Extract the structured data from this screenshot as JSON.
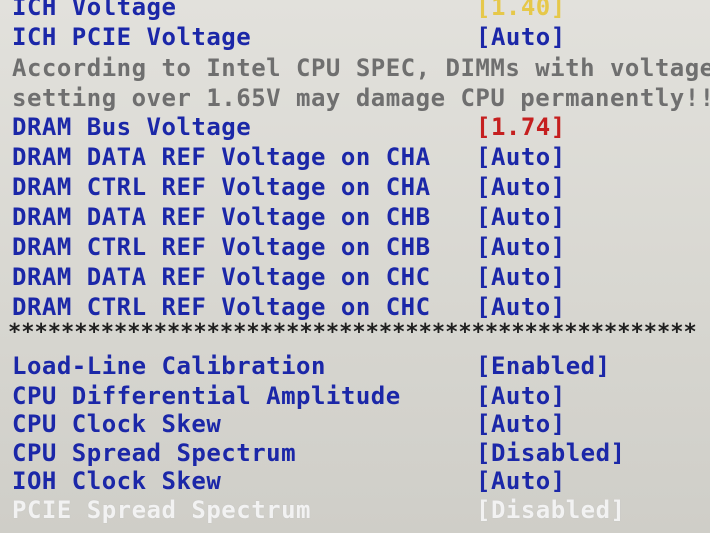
{
  "rows": [
    {
      "label": "ICH Voltage",
      "value": "[1.40]"
    },
    {
      "label": "ICH PCIE Voltage",
      "value": "[Auto]"
    },
    {
      "label": "DRAM Bus Voltage",
      "value": "[1.74]"
    },
    {
      "label": "DRAM DATA REF Voltage on CHA",
      "value": "[Auto]"
    },
    {
      "label": "DRAM CTRL REF Voltage on CHA",
      "value": "[Auto]"
    },
    {
      "label": "DRAM DATA REF Voltage on CHB",
      "value": "[Auto]"
    },
    {
      "label": "DRAM CTRL REF Voltage on CHB",
      "value": "[Auto]"
    },
    {
      "label": "DRAM DATA REF Voltage on CHC",
      "value": "[Auto]"
    },
    {
      "label": "DRAM CTRL REF Voltage on CHC",
      "value": "[Auto]"
    },
    {
      "label": "Load-Line Calibration",
      "value": "[Enabled]"
    },
    {
      "label": "CPU Differential Amplitude",
      "value": "[Auto]"
    },
    {
      "label": "CPU Clock Skew",
      "value": "[Auto]"
    },
    {
      "label": "CPU Spread Spectrum",
      "value": "[Disabled]"
    },
    {
      "label": "IOH Clock Skew",
      "value": "[Auto]"
    },
    {
      "label": "PCIE Spread Spectrum",
      "value": "[Disabled]"
    }
  ],
  "warning": {
    "line1": "According to Intel CPU SPEC, DIMMs with voltage",
    "line2": "setting over 1.65V may damage CPU permanently!!"
  },
  "separator": "****************************************************",
  "colors": {
    "label": "#1b27a8",
    "value_yellow": "#e6c84a",
    "value_red": "#c51f1f",
    "warning_text": "#6f6f6f",
    "disabled_text": "#f2f2f2"
  }
}
